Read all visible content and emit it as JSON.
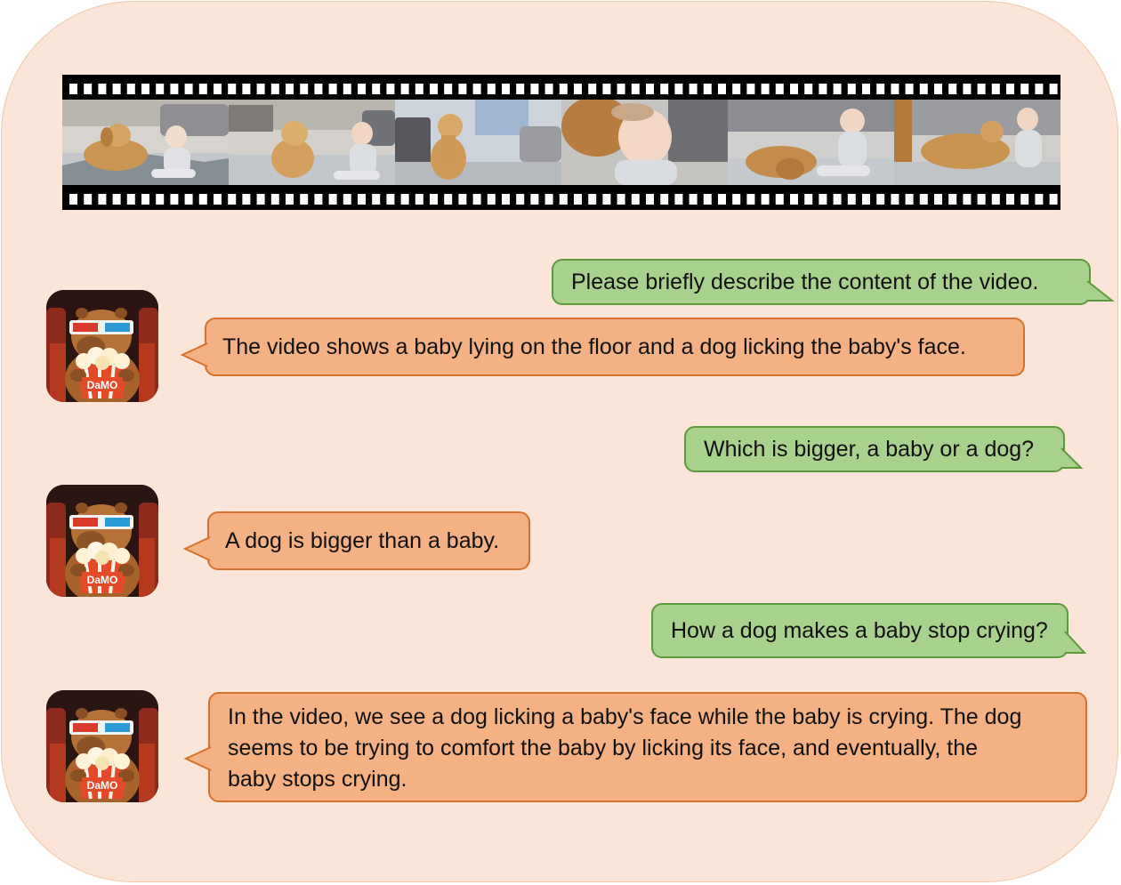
{
  "panel": {
    "background": "#fbe5d8",
    "border": "#f3c8a8"
  },
  "colors": {
    "user_bubble": "#a9d18e",
    "user_border": "#5d9a3c",
    "bot_bubble": "#f4b183",
    "bot_border": "#d8712c"
  },
  "video": {
    "frames": [
      {
        "scene": "dog-lying-baby-sitting"
      },
      {
        "scene": "dog-sitting-baby-crying"
      },
      {
        "scene": "dog-sitting-alone"
      },
      {
        "scene": "dog-licking-baby-face"
      },
      {
        "scene": "dog-lying-baby-sitting-rug"
      },
      {
        "scene": "dog-lying-baby-turned-away"
      }
    ]
  },
  "conversation": [
    {
      "role": "user",
      "text": "Please briefly describe the content of the video."
    },
    {
      "role": "assistant",
      "text": "The video shows a baby lying on the floor and a dog licking the baby's face."
    },
    {
      "role": "user",
      "text": "Which is bigger, a baby or a dog?"
    },
    {
      "role": "assistant",
      "text": "A dog is bigger than a baby."
    },
    {
      "role": "user",
      "text": "How a dog makes a baby stop crying?"
    },
    {
      "role": "assistant",
      "lines": [
        "In the video, we see a dog licking a baby's face while the baby is crying. The dog",
        "seems to be trying to comfort the baby by licking its face, and eventually, the",
        "baby stops crying."
      ]
    }
  ],
  "avatar": {
    "icon": "capybara-popcorn-3d-glasses",
    "label": "DaMO"
  }
}
